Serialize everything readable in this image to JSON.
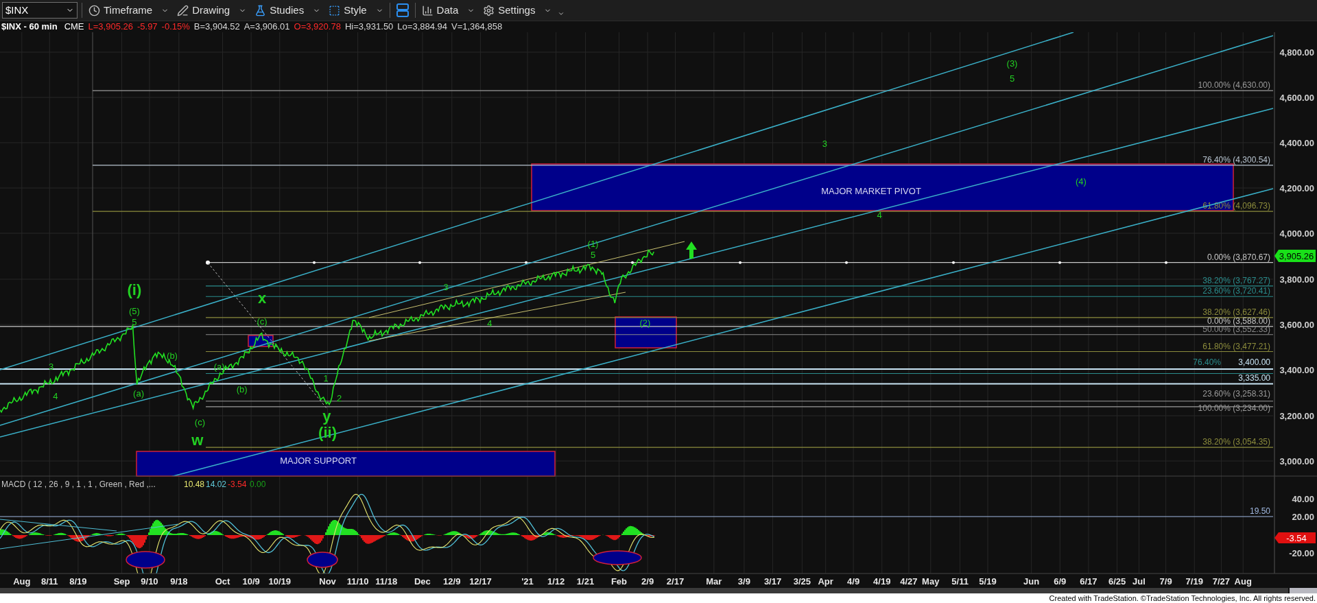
{
  "toolbar": {
    "symbol": "$INX",
    "menus": [
      {
        "label": "Timeframe"
      },
      {
        "label": "Drawing"
      },
      {
        "label": "Studies"
      },
      {
        "label": "Style"
      },
      {
        "label": "Data"
      },
      {
        "label": "Settings"
      }
    ]
  },
  "quote": {
    "title": "$INX - 60 min",
    "exchange": "CME",
    "fields": [
      {
        "text": "L=3,905.26",
        "color": "#ff2a2a"
      },
      {
        "text": "-5.97",
        "color": "#ff2a2a"
      },
      {
        "text": "-0.15%",
        "color": "#ff2a2a"
      },
      {
        "text": "B=3,904.52",
        "color": "#d8d8d8"
      },
      {
        "text": "A=3,906.01",
        "color": "#d8d8d8"
      },
      {
        "text": "O=3,920.78",
        "color": "#ff2a2a"
      },
      {
        "text": "Hi=3,931.50",
        "color": "#d8d8d8"
      },
      {
        "text": "Lo=3,884.94",
        "color": "#d8d8d8"
      },
      {
        "text": "V=1,364,858",
        "color": "#d8d8d8"
      }
    ]
  },
  "price_chart": {
    "y_axis": [
      "4,800.00",
      "4,600.00",
      "4,400.00",
      "4,200.00",
      "4,000.00",
      "3,800.00",
      "3,600.00",
      "3,400.00",
      "3,200.00",
      "3,000.00"
    ],
    "last_price": "3,905.26",
    "fib_levels": [
      {
        "text": "100.00% (4,630.00)",
        "color": "#9a9a9a"
      },
      {
        "text": "76.40% (4,300.54)",
        "color": "#b8c4d0"
      },
      {
        "text": "61.80% (4,096.73)",
        "color": "#8c8c3c"
      },
      {
        "text": "0.00% (3,870.67)",
        "color": "#c8c8c8"
      },
      {
        "text": "38.20% (3,767.27)",
        "color": "#2a8c8c"
      },
      {
        "text": "23.60% (3,720.41)",
        "color": "#2a8c8c"
      },
      {
        "text": "38.20% (3,627.46)",
        "color": "#8c8c3c"
      },
      {
        "text": "0.00% (3,588.00)",
        "color": "#c8c8c8"
      },
      {
        "text": "50.00% (3,552.33)",
        "color": "#8a8a8a"
      },
      {
        "text": "61.80% (3,477.21)",
        "color": "#8c8c3c"
      },
      {
        "text": "3,400.00",
        "color": "#c8e4f4"
      },
      {
        "text": "76.40%",
        "color": "#2a8c8c"
      },
      {
        "text": "3,335.00",
        "color": "#c8e4f4"
      },
      {
        "text": "23.60% (3,258.31)",
        "color": "#9a9a9a"
      },
      {
        "text": "100.00% (3,234.00)",
        "color": "#9a9a9a"
      },
      {
        "text": "38.20% (3,054.35)",
        "color": "#8c8c3c"
      }
    ],
    "zones": [
      {
        "text": "MAJOR MARKET PIVOT"
      },
      {
        "text": "MAJOR SUPPORT"
      }
    ],
    "wave_labels": [
      {
        "text": "(3)",
        "kind": "minor"
      },
      {
        "text": "5",
        "kind": "minor"
      },
      {
        "text": "3",
        "kind": "minor"
      },
      {
        "text": "(4)",
        "kind": "minor"
      },
      {
        "text": "4",
        "kind": "minor"
      },
      {
        "text": "(1)",
        "kind": "minor"
      },
      {
        "text": "5",
        "kind": "minor"
      },
      {
        "text": "(i)",
        "kind": "major"
      },
      {
        "text": "(5)",
        "kind": "minor"
      },
      {
        "text": "5",
        "kind": "minor"
      },
      {
        "text": "x",
        "kind": "major"
      },
      {
        "text": "(c)",
        "kind": "minor"
      },
      {
        "text": "3",
        "kind": "minor"
      },
      {
        "text": "3",
        "kind": "minor"
      },
      {
        "text": "4",
        "kind": "minor"
      },
      {
        "text": "(b)",
        "kind": "minor"
      },
      {
        "text": "(a)",
        "kind": "minor"
      },
      {
        "text": "(c)",
        "kind": "minor"
      },
      {
        "text": "w",
        "kind": "major"
      },
      {
        "text": "(a)",
        "kind": "minor"
      },
      {
        "text": "(b)",
        "kind": "minor"
      },
      {
        "text": "1",
        "kind": "minor"
      },
      {
        "text": "2",
        "kind": "minor"
      },
      {
        "text": "y",
        "kind": "major"
      },
      {
        "text": "(ii)",
        "kind": "major"
      },
      {
        "text": "4",
        "kind": "minor"
      },
      {
        "text": "(2)",
        "kind": "minor"
      }
    ]
  },
  "macd": {
    "title": "MACD ( 12 , 26 , 9 , 1 , 1 , Green , Red ,...",
    "values": [
      {
        "text": "10.48",
        "color": "#e8e870"
      },
      {
        "text": "14.02",
        "color": "#60c8d8"
      },
      {
        "text": "-3.54",
        "color": "#ff2a2a"
      },
      {
        "text": "0.00",
        "color": "#18a018"
      }
    ],
    "axis": [
      "40.00",
      "20.00",
      "-20.00"
    ],
    "level_line": "19.50",
    "last_value": "-3.54"
  },
  "x_axis": [
    "Aug",
    "8/11",
    "8/19",
    "Sep",
    "9/10",
    "9/18",
    "Oct",
    "10/9",
    "10/19",
    "Nov",
    "11/10",
    "11/18",
    "Dec",
    "12/9",
    "12/17",
    "'21",
    "1/12",
    "1/21",
    "Feb",
    "2/9",
    "2/17",
    "Mar",
    "3/9",
    "3/17",
    "3/25",
    "Apr",
    "4/9",
    "4/19",
    "4/27",
    "May",
    "5/11",
    "5/19",
    "Jun",
    "6/9",
    "6/17",
    "6/25",
    "Jul",
    "7/9",
    "7/19",
    "7/27",
    "Aug"
  ],
  "footer": "Created with TradeStation. ©TradeStation Technologies, Inc. All rights reserved."
}
